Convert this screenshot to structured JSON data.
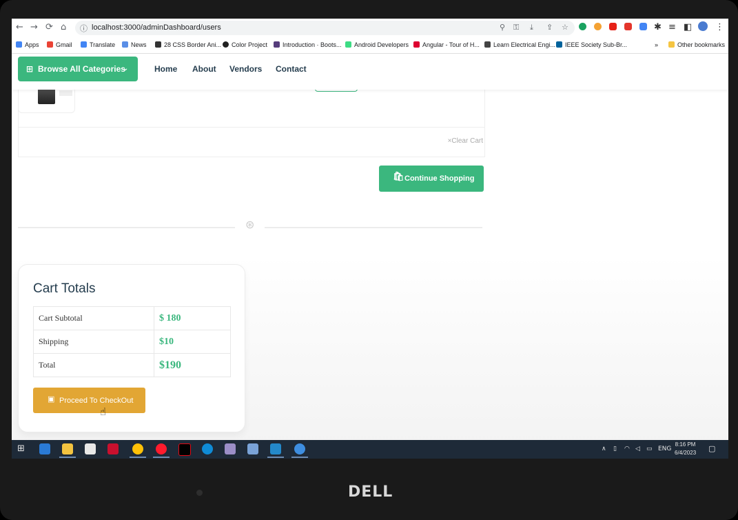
{
  "browser": {
    "url": "localhost:3000/adminDashboard/users",
    "bookmarks": [
      "Apps",
      "Gmail",
      "Translate",
      "News",
      "28 CSS Border Ani...",
      "Color Project",
      "Introduction · Boots...",
      "Android Developers",
      "Angular - Tour of H...",
      "Learn Electrical Engi...",
      "IEEE Society Sub-Br..."
    ],
    "other_bookmarks": "Other bookmarks",
    "overflow": "»"
  },
  "header": {
    "browse_label": "Browse All Categories",
    "nav": [
      "Home",
      "About",
      "Vendors",
      "Contact"
    ]
  },
  "cart": {
    "clear_label": "Clear Cart",
    "continue_label": "Continue Shopping"
  },
  "totals": {
    "title": "Cart Totals",
    "rows": [
      {
        "label": "Cart Subtotal",
        "value": "$ 180"
      },
      {
        "label": "Shipping",
        "value": "$10"
      },
      {
        "label": "Total",
        "value": "$190"
      }
    ],
    "checkout_label": "Proceed To CheckOut"
  },
  "taskbar": {
    "lang": "ENG",
    "time": "8:16 PM",
    "date": "6/4/2023"
  },
  "device": {
    "brand": "DELL"
  },
  "colors": {
    "accent": "#3bb77e",
    "checkout": "#e2a634"
  }
}
